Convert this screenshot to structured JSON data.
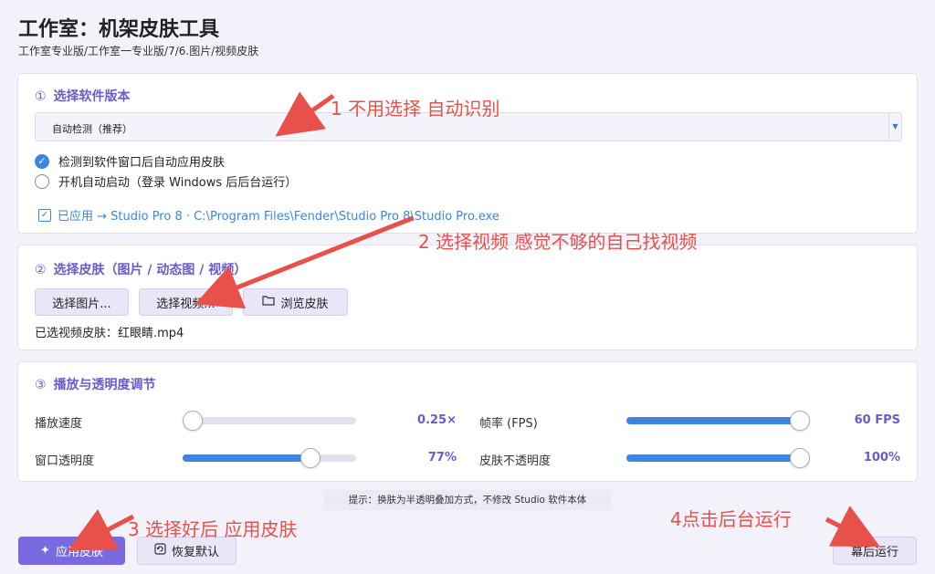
{
  "header": {
    "title": "工作室：机架皮肤工具",
    "breadcrumb": "工作室专业版/工作室一专业版/7/6.图片/视频皮肤"
  },
  "section1": {
    "num": "①",
    "title": "选择软件版本",
    "select_value": "自动检测（推荐）",
    "option_auto_apply": "检测到软件窗口后自动应用皮肤",
    "option_auto_apply_checked": true,
    "option_startup": "开机自动启动（登录 Windows 后后台运行）",
    "option_startup_checked": false,
    "applied_text": "已应用 → Studio Pro 8 · C:\\Program Files\\Fender\\Studio Pro 8\\Studio Pro.exe"
  },
  "section2": {
    "num": "②",
    "title": "选择皮肤（图片 / 动态图 / 视频）",
    "btn_image": "选择图片...",
    "btn_video": "选择视频...",
    "btn_browse": "浏览皮肤",
    "selected_file": "已选视频皮肤：红眼睛.mp4"
  },
  "section3": {
    "num": "③",
    "title": "播放与透明度调节",
    "sliders": [
      {
        "label": "播放速度",
        "value_text": "0.25×",
        "level": 0
      },
      {
        "label": "帧率 (FPS)",
        "value_text": "60 FPS",
        "level": 1.0
      },
      {
        "label": "窗口透明度",
        "value_text": "77%",
        "level": 0.77
      },
      {
        "label": "皮肤不透明度",
        "value_text": "100%",
        "level": 1.0
      }
    ]
  },
  "tip": "提示：换肤为半透明叠加方式，不修改 Studio 软件本体",
  "footer": {
    "apply_label": "应用皮肤",
    "reset_label": "恢复默认",
    "background_label": "幕后运行"
  },
  "annotations": {
    "a1": "1  不用选择 自动识别",
    "a2": "2 选择视频  感觉不够的自己找视频",
    "a3": "3 选择好后  应用皮肤",
    "a4": "4点击后台运行"
  },
  "colors": {
    "accent": "#6a5acd",
    "primary_button": "#7a6ae0",
    "slider_fill": "#3a86e0",
    "annotation": "#e8504a"
  }
}
